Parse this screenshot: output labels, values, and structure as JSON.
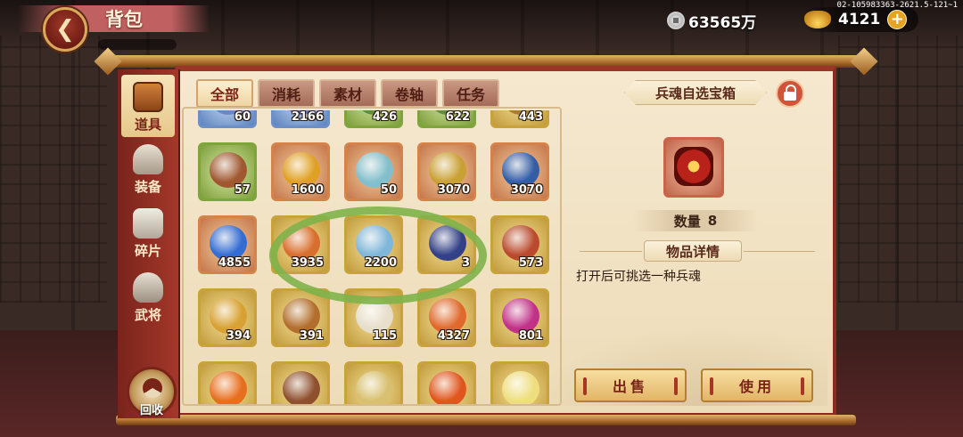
{
  "header": {
    "title": "背包",
    "version": "02-105983363-2621.5-121~1",
    "silver": "63565万",
    "gold": "4121",
    "plus": "+"
  },
  "sidebar": {
    "items": [
      {
        "label": "道具",
        "icon": "chest-icon",
        "active": true
      },
      {
        "label": "装备",
        "icon": "armor-icon",
        "active": false
      },
      {
        "label": "碎片",
        "icon": "puzzle-icon",
        "active": false
      },
      {
        "label": "武将",
        "icon": "helmet-icon",
        "active": false
      }
    ],
    "recycle_label": "回收"
  },
  "tabs": [
    {
      "label": "全部",
      "active": true
    },
    {
      "label": "消耗",
      "active": false
    },
    {
      "label": "素材",
      "active": false
    },
    {
      "label": "卷轴",
      "active": false
    },
    {
      "label": "任务",
      "active": false
    }
  ],
  "items": [
    {
      "count": "60",
      "quality": "blue",
      "art": "#6a86c0"
    },
    {
      "count": "2166",
      "quality": "blue",
      "art": "#5a6fa8"
    },
    {
      "count": "426",
      "quality": "green",
      "art": "#5f8a3a"
    },
    {
      "count": "622",
      "quality": "green",
      "art": "#5f8a3a"
    },
    {
      "count": "443",
      "quality": "gold",
      "art": "#a87a2a"
    },
    {
      "count": "57",
      "quality": "green",
      "art": "#a0522d"
    },
    {
      "count": "1600",
      "quality": "orange",
      "art": "#e0a020"
    },
    {
      "count": "50",
      "quality": "orange",
      "art": "#7ec0d0"
    },
    {
      "count": "3070",
      "quality": "orange",
      "art": "#c8a030"
    },
    {
      "count": "3070",
      "quality": "orange",
      "art": "#2a5aa8"
    },
    {
      "count": "4855",
      "quality": "orange",
      "art": "#2a6ad8"
    },
    {
      "count": "3935",
      "quality": "gold",
      "art": "#d86a2a"
    },
    {
      "count": "2200",
      "quality": "gold",
      "art": "#7ab6e0"
    },
    {
      "count": "3",
      "quality": "gold",
      "art": "#2a3a8a"
    },
    {
      "count": "573",
      "quality": "gold",
      "art": "#b8442a"
    },
    {
      "count": "394",
      "quality": "gold",
      "art": "#d8a030"
    },
    {
      "count": "391",
      "quality": "gold",
      "art": "#b06a2a"
    },
    {
      "count": "115",
      "quality": "gold",
      "art": "#e8e0d0"
    },
    {
      "count": "4327",
      "quality": "gold",
      "art": "#e0642a"
    },
    {
      "count": "801",
      "quality": "gold",
      "art": "#c02a8a"
    },
    {
      "count": "",
      "quality": "gold",
      "art": "#e86a1a"
    },
    {
      "count": "",
      "quality": "gold",
      "art": "#8a4a2a"
    },
    {
      "count": "",
      "quality": "gold",
      "art": "#d8c070"
    },
    {
      "count": "",
      "quality": "gold",
      "art": "#e0501a"
    },
    {
      "count": "",
      "quality": "gold",
      "art": "#f0e080"
    }
  ],
  "detail": {
    "name": "兵魂自选宝箱",
    "qty_label": "数量",
    "qty_value": "8",
    "section_title": "物品详情",
    "description": "打开后可挑选一种兵魂",
    "sell_label": "出售",
    "use_label": "使用"
  },
  "colors": {
    "accent": "#7a2418",
    "highlight_circle": "#7fb24a"
  }
}
